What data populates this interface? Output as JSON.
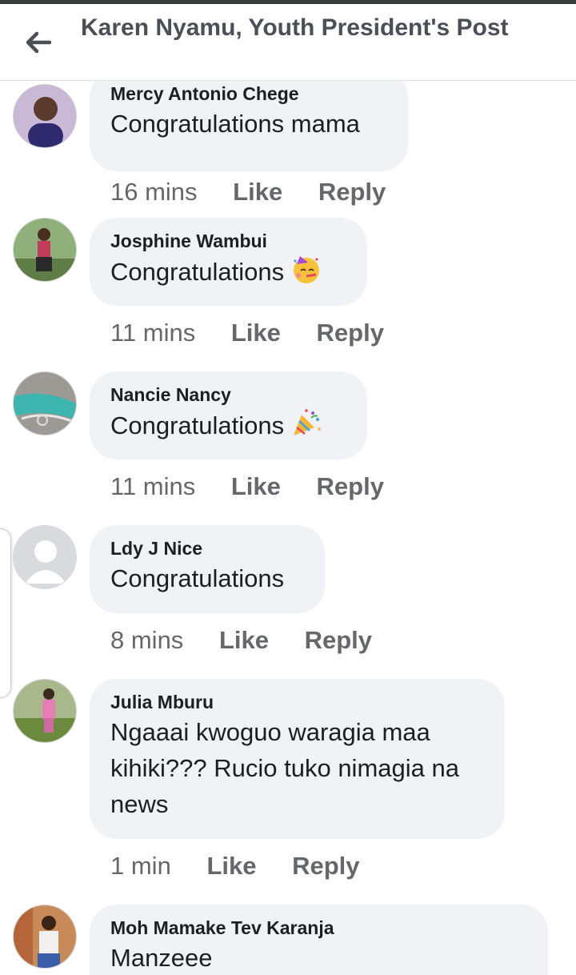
{
  "header": {
    "title": "Karen Nyamu, Youth President's Post",
    "back_icon": "arrow-left-icon"
  },
  "comments": [
    {
      "author": "Mercy Antonio Chege",
      "text": "Congratulations mama",
      "time": "16 mins",
      "like": "Like",
      "reply": "Reply",
      "avatar": "profile-photo"
    },
    {
      "author": "Josphine Wambui",
      "text": "Congratulations",
      "emoji": "partying-face-icon",
      "time": "11 mins",
      "like": "Like",
      "reply": "Reply",
      "avatar": "profile-photo"
    },
    {
      "author": "Nancie Nancy",
      "text": "Congratulations",
      "emoji": "party-popper-icon",
      "time": "11 mins",
      "like": "Like",
      "reply": "Reply",
      "avatar": "profile-photo"
    },
    {
      "author": "Ldy J Nice",
      "text": "Congratulations",
      "time": "8 mins",
      "like": "Like",
      "reply": "Reply",
      "avatar": "default-avatar-icon"
    },
    {
      "author": "Julia Mburu",
      "text_lines": [
        "Ngaaai kwoguo waragia maa",
        "kihiki??? Rucio tuko nimagia na",
        "news"
      ],
      "time": "1 min",
      "like": "Like",
      "reply": "Reply",
      "avatar": "profile-photo"
    },
    {
      "author": "Moh Mamake Tev Karanja",
      "text": "Manzeee",
      "avatar": "profile-photo"
    }
  ],
  "colors": {
    "bubble": "#f0f2f5",
    "header_text": "#4b4f56",
    "meta_text": "#65676b"
  }
}
